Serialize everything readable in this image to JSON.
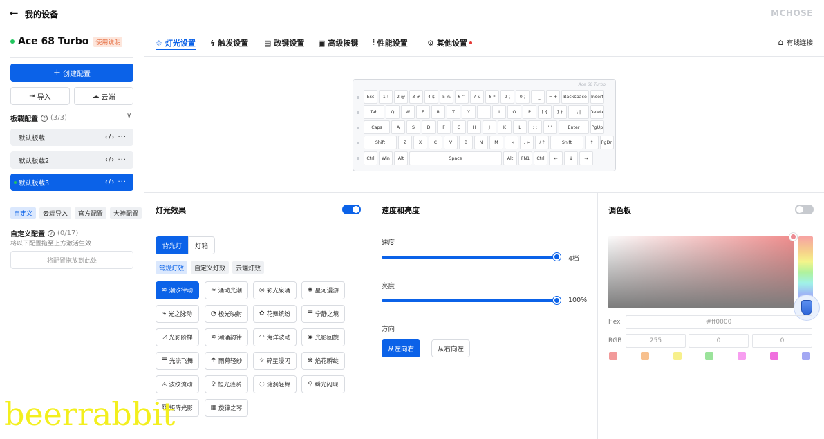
{
  "topbar": {
    "back_icon": "arrow-left-icon",
    "title": "我的设备",
    "brand": "MCHOSE"
  },
  "sidebar": {
    "device_name": "Ace 68 Turbo",
    "manual_badge": "使用说明",
    "create_label": "创建配置",
    "import_label": "导入",
    "cloud_label": "云端",
    "profiles_title": "板载配置",
    "profiles_count": "(3/3)",
    "profiles": [
      {
        "label": "默认板载",
        "actions": "‹/›  ···"
      },
      {
        "label": "默认板载2",
        "actions": "‹/›  ···"
      },
      {
        "label": "默认板载3",
        "actions": "‹/›  ···"
      }
    ],
    "tags": [
      "自定义",
      "云端导入",
      "官方配置",
      "大神配置"
    ],
    "custom_title": "自定义配置",
    "custom_count": "(0/17)",
    "custom_hint": "将以下配置拖至上方激活生效",
    "drop_hint": "将配置拖放到此处"
  },
  "tabs": [
    {
      "label": "灯光设置",
      "icon": "bulb-icon"
    },
    {
      "label": "触发设置",
      "icon": "lightning-icon"
    },
    {
      "label": "改键设置",
      "icon": "keyboard-icon"
    },
    {
      "label": "高级按键",
      "icon": "advanced-key-icon"
    },
    {
      "label": "性能设置",
      "icon": "sliders-icon"
    },
    {
      "label": "其他设置",
      "icon": "gear-icon"
    }
  ],
  "connection": {
    "label": "有线连接",
    "icon": "wired-icon"
  },
  "keyboard": {
    "brand": "Ace 68 Turbo",
    "rows": [
      [
        "Esc",
        "1 !",
        "2 @",
        "3 #",
        "4 $",
        "5 %",
        "6 ^",
        "7 &",
        "8 *",
        "9 (",
        "0 )",
        "- _",
        "= +",
        "Backspace",
        "Insert"
      ],
      [
        "Tab",
        "Q",
        "W",
        "E",
        "R",
        "T",
        "Y",
        "U",
        "I",
        "O",
        "P",
        "[ {",
        "] }",
        "\\ |",
        "Delete"
      ],
      [
        "Caps",
        "A",
        "S",
        "D",
        "F",
        "G",
        "H",
        "J",
        "K",
        "L",
        "; :",
        "' \"",
        "Enter",
        "PgUp"
      ],
      [
        "Shift",
        "Z",
        "X",
        "C",
        "V",
        "B",
        "N",
        "M",
        ", <",
        ". >",
        "/ ?",
        "Shift",
        "↑",
        "PgDn"
      ],
      [
        "Ctrl",
        "Win",
        "Alt",
        "Space",
        "Alt",
        "FN1",
        "Ctrl",
        "←",
        "↓",
        "→"
      ]
    ]
  },
  "lighting": {
    "title": "灯光效果",
    "enabled": true,
    "segments": [
      "背光灯",
      "灯箱"
    ],
    "subtabs": [
      "常规灯效",
      "自定义灯效",
      "云端灯效"
    ],
    "effects": [
      "潮汐律动",
      "涌动光潮",
      "彩光泉涌",
      "星河漫游",
      "光之脉动",
      "极光映射",
      "花舞缤纷",
      "宁静之境",
      "光影阶梯",
      "潮涌韵律",
      "海洋波动",
      "光影回旋",
      "光流飞舞",
      "雨幕轻纱",
      "碎星漫闪",
      "焰花瞬绽",
      "波纹流动",
      "恒光涟漪",
      "涟漪轻舞",
      "瞬光闪现",
      "矩阵光影",
      "旋律之琴"
    ],
    "effect_icons": [
      "waves-icon",
      "wave-lines-icon",
      "target-icon",
      "spiral-icon",
      "pulse-icon",
      "aurora-icon",
      "flower-icon",
      "calm-icon",
      "stairs-icon",
      "tide-icon",
      "ocean-icon",
      "swirl-icon",
      "flow-icon",
      "rain-icon",
      "stars-icon",
      "sparkle-icon",
      "ripple-icon",
      "bulb-ring-icon",
      "ripple-dance-icon",
      "flash-icon",
      "matrix-icon",
      "piano-icon"
    ]
  },
  "speed_brightness": {
    "title": "速度和亮度",
    "speed_label": "速度",
    "speed_value": "4档",
    "speed_level": 1.0,
    "brightness_label": "亮度",
    "brightness_value": "100%",
    "brightness_level": 1.0,
    "direction_label": "方向",
    "direction_options": [
      "从左向右",
      "从右向左"
    ]
  },
  "palette": {
    "title": "调色板",
    "enabled": false,
    "hex_label": "Hex",
    "hex_value": "#ff0000",
    "rgb_label": "RGB",
    "rgb": [
      "255",
      "0",
      "0"
    ],
    "swatches": [
      "#f29a9a",
      "#f7c08e",
      "#f7f08c",
      "#9be39b",
      "#f79ef0",
      "#f06fde",
      "#a3a8f3"
    ]
  },
  "watermark": "beerrabbit",
  "colors": {
    "accent": "#0b62e8",
    "online": "#22c55e",
    "badge": "#e56a3d"
  }
}
